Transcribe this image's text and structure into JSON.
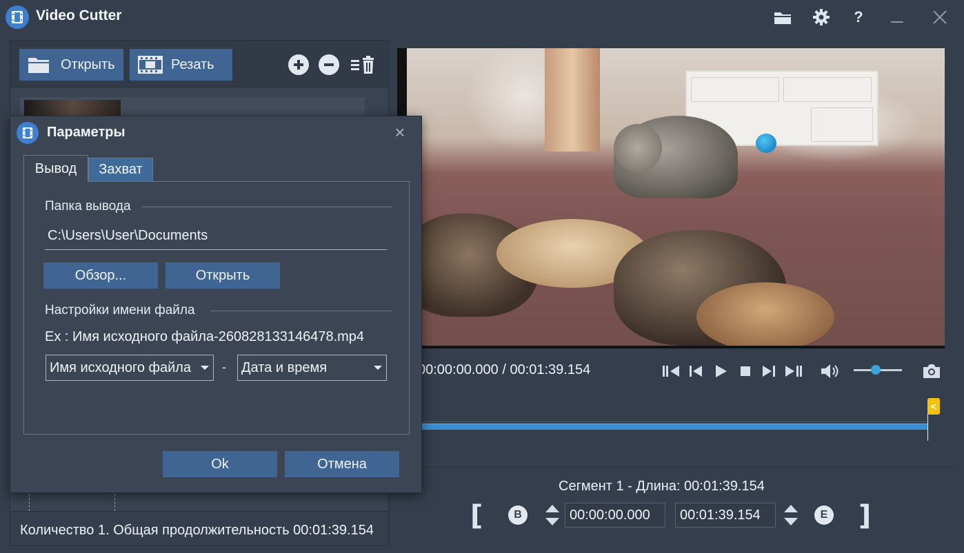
{
  "app": {
    "title": "Video Cutter"
  },
  "toolbar": {
    "open_label": "Открыть",
    "cut_label": "Резать"
  },
  "status": {
    "summary": "Количество 1. Общая продолжительность 00:01:39.154"
  },
  "player": {
    "time": "00:00:00.000 / 00:01:39.154",
    "volume_level": 0.45
  },
  "segment": {
    "label": "Сегмент 1 - Длина: 00:01:39.154",
    "begin": "00:00:00.000",
    "end": "00:01:39.154",
    "begin_letter": "B",
    "end_letter": "E"
  },
  "timeline": {
    "marker_glyph": "<"
  },
  "dialog": {
    "title": "Параметры",
    "tabs": [
      "Вывод",
      "Захват"
    ],
    "output_folder_label": "Папка вывода",
    "output_path": "C:\\Users\\User\\Documents",
    "browse_label": "Обзор...",
    "open_label": "Открыть",
    "filename_settings_label": "Настройки имени файла",
    "example": "Ex : Имя исходного файла-260828133146478.mp4",
    "name_part1": "Имя исходного файла",
    "separator": "-",
    "name_part2": "Дата и время",
    "ok_label": "Ok",
    "cancel_label": "Отмена"
  },
  "colors": {
    "accent": "#416592",
    "timeline": "#3a8fd0",
    "marker": "#f1c40f"
  }
}
